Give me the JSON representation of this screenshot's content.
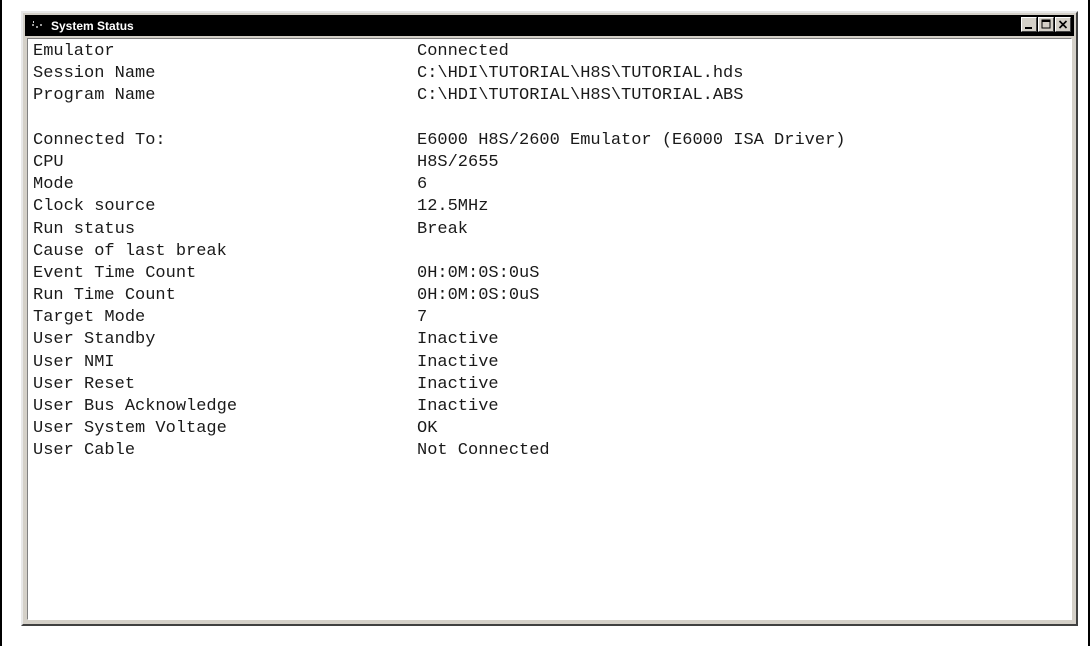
{
  "window": {
    "title": "System Status",
    "icon": "app-icon",
    "buttons": [
      "minimize-icon",
      "maximize-icon",
      "close-icon"
    ],
    "colors": {
      "titlebar": "#000000",
      "chrome": "#d4d0c8",
      "content_bg": "#ffffff"
    }
  },
  "status": {
    "emulator": {
      "label": "Emulator",
      "value": "Connected"
    },
    "session_name": {
      "label": "Session Name",
      "value": "C:\\HDI\\TUTORIAL\\H8S\\TUTORIAL.hds"
    },
    "program_name": {
      "label": "Program Name",
      "value": "C:\\HDI\\TUTORIAL\\H8S\\TUTORIAL.ABS"
    },
    "connected_to": {
      "label": "Connected To:",
      "value": "E6000 H8S/2600 Emulator (E6000 ISA Driver)"
    },
    "cpu": {
      "label": "CPU",
      "value": "H8S/2655"
    },
    "mode": {
      "label": "Mode",
      "value": "6"
    },
    "clock_source": {
      "label": "Clock source",
      "value": "12.5MHz"
    },
    "run_status": {
      "label": "Run status",
      "value": "Break"
    },
    "cause_of_last_break": {
      "label": "Cause of last break",
      "value": ""
    },
    "event_time_count": {
      "label": "Event Time Count",
      "value": "0H:0M:0S:0uS"
    },
    "run_time_count": {
      "label": "Run Time Count",
      "value": "0H:0M:0S:0uS"
    },
    "target_mode": {
      "label": "Target Mode",
      "value": "7"
    },
    "user_standby": {
      "label": "User Standby",
      "value": "Inactive"
    },
    "user_nmi": {
      "label": "User NMI",
      "value": "Inactive"
    },
    "user_reset": {
      "label": "User Reset",
      "value": "Inactive"
    },
    "user_bus_acknowledge": {
      "label": "User Bus Acknowledge",
      "value": "Inactive"
    },
    "user_system_voltage": {
      "label": "User System Voltage",
      "value": "OK"
    },
    "user_cable": {
      "label": "User Cable",
      "value": "Not Connected"
    }
  }
}
